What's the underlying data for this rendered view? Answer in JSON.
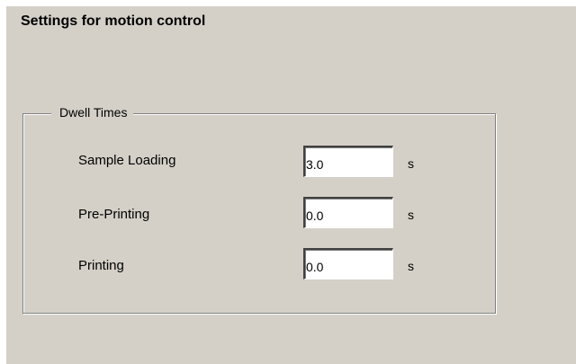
{
  "header": {
    "title": "Settings for motion control"
  },
  "dwell_times": {
    "group_label": "Dwell Times",
    "rows": [
      {
        "label": "Sample Loading",
        "value": "3.0",
        "unit": "s"
      },
      {
        "label": "Pre-Printing",
        "value": "0.0",
        "unit": "s"
      },
      {
        "label": "Printing",
        "value": "0.0",
        "unit": "s"
      }
    ]
  }
}
